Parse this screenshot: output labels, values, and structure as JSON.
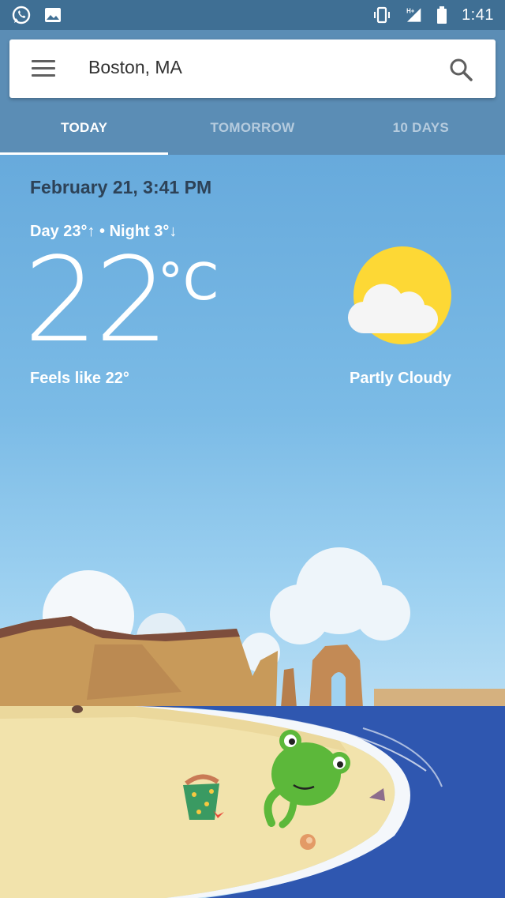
{
  "status_bar": {
    "time": "1:41",
    "network": "H+",
    "left_icons": [
      "whatsapp-icon",
      "gallery-icon"
    ],
    "right_icons": [
      "vibrate-icon",
      "signal-icon",
      "battery-icon"
    ]
  },
  "search": {
    "location": "Boston, MA",
    "menu_icon": "menu-icon",
    "search_icon": "search-icon"
  },
  "tabs": [
    {
      "label": "TODAY",
      "active": true
    },
    {
      "label": "TOMORROW",
      "active": false
    },
    {
      "label": "10 DAYS",
      "active": false
    }
  ],
  "weather": {
    "date_time": "February 21, 3:41 PM",
    "day_night": "Day 23°↑ • Night 3°↓",
    "temperature": "22",
    "unit": "°C",
    "feels_like": "Feels like 22°",
    "condition": "Partly Cloudy",
    "condition_icon": "partly-cloudy-icon"
  },
  "colors": {
    "status_bar": "#3f6f94",
    "header": "#5b8db5",
    "sky_top": "#67aadc",
    "sun": "#fdd835",
    "sea": "#2f57b0",
    "sand": "#f2e3ac"
  }
}
